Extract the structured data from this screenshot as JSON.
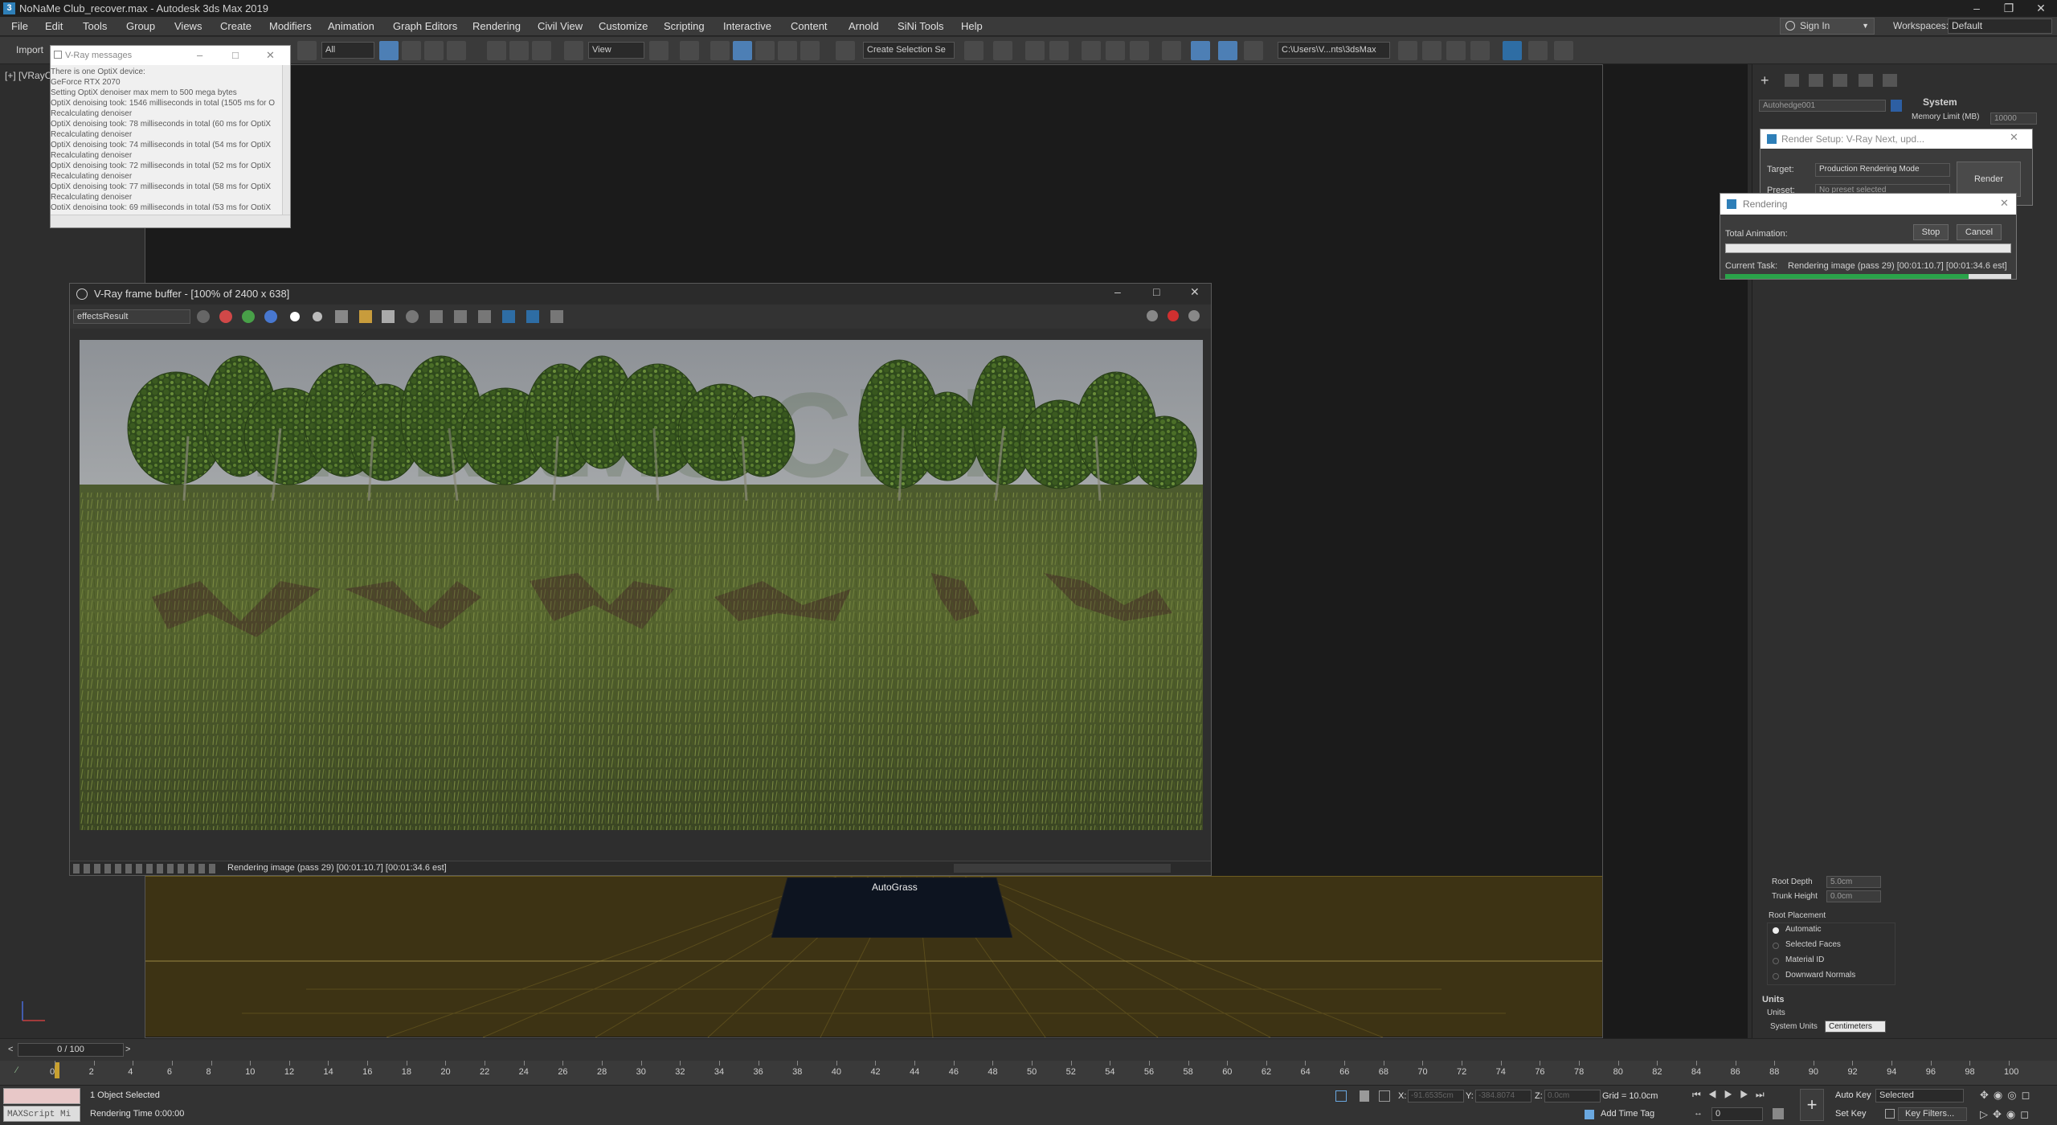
{
  "app": {
    "title": "NoNaMe Club_recover.max - Autodesk 3ds Max 2019",
    "menus": [
      "File",
      "Edit",
      "Tools",
      "Group",
      "Views",
      "Create",
      "Modifiers",
      "Animation",
      "Graph Editors",
      "Rendering",
      "Civil View",
      "Customize",
      "Scripting",
      "Interactive",
      "Content",
      "Arnold",
      "SiNi Tools",
      "Help"
    ],
    "sign_in": "Sign In",
    "workspaces_label": "Workspaces:",
    "workspaces_value": "Default"
  },
  "toolbar": {
    "import": "Import",
    "filter": "All",
    "view": "View",
    "create_selection": "Create Selection Se",
    "path": "C:\\Users\\V...nts\\3dsMax"
  },
  "viewport": {
    "label": "[+] [VRayC",
    "object_label": "AutoGrass"
  },
  "vray_messages": {
    "title": "V-Ray messages",
    "lines": [
      "There is one OptiX device:",
      "  GeForce RTX 2070",
      "Setting OptiX denoiser max mem to 500 mega bytes",
      "OptiX denoising took: 1546 milliseconds in total (1505 ms for O",
      "Recalculating denoiser",
      "OptiX denoising took: 78 milliseconds in total (60 ms for OptiX",
      "Recalculating denoiser",
      "OptiX denoising took: 74 milliseconds in total (54 ms for OptiX",
      "Recalculating denoiser",
      "OptiX denoising took: 72 milliseconds in total (52 ms for OptiX",
      "Recalculating denoiser",
      "OptiX denoising took: 77 milliseconds in total (58 ms for OptiX",
      "Recalculating denoiser",
      "OptiX denoising took: 69 milliseconds in total (53 ms for OptiX"
    ]
  },
  "render_setup": {
    "title": "Render Setup: V-Ray Next, upd...",
    "target_label": "Target:",
    "target_value": "Production Rendering Mode",
    "preset_label": "Preset:",
    "preset_value": "No preset selected",
    "render_button": "Render"
  },
  "rendering_dialog": {
    "title": "Rendering",
    "total_animation": "Total Animation:",
    "stop": "Stop",
    "cancel": "Cancel",
    "current_task_label": "Current Task:",
    "current_task_value": "Rendering image (pass 29) [00:01:10.7] [00:01:34.6 est]",
    "progress": 0.85
  },
  "frame_buffer": {
    "title": "V-Ray frame buffer - [100% of 2400 x 638]",
    "channel": "effectsResult",
    "status": "Rendering image (pass 29) [00:01:10.7] [00:01:34.6 est]"
  },
  "command_panel": {
    "object_name": "Autohedge001",
    "system_header": "System",
    "memory_limit_label": "Memory Limit (MB)",
    "memory_limit_value": "10000",
    "root_depth_label": "Root Depth",
    "root_depth_value": "5.0cm",
    "trunk_height_label": "Trunk Height",
    "trunk_height_value": "0.0cm",
    "root_placement_label": "Root Placement",
    "root_options": [
      "Automatic",
      "Selected Faces",
      "Material ID",
      "Downward Normals"
    ],
    "units_header": "Units",
    "units_label": "Units",
    "system_units_label": "System Units",
    "system_units_value": "Centimeters"
  },
  "timeline": {
    "frame_display": "0 / 100",
    "ticks": [
      "0",
      "2",
      "4",
      "6",
      "8",
      "10",
      "12",
      "14",
      "16",
      "18",
      "20",
      "22",
      "24",
      "26",
      "28",
      "30",
      "32",
      "34",
      "36",
      "38",
      "40",
      "42",
      "44",
      "46",
      "48",
      "50",
      "52",
      "54",
      "56",
      "58",
      "60",
      "62",
      "64",
      "66",
      "68",
      "70",
      "72",
      "74",
      "76",
      "78",
      "80",
      "82",
      "84",
      "86",
      "88",
      "90",
      "92",
      "94",
      "96",
      "98",
      "100"
    ]
  },
  "statusbar": {
    "maxscript": "MAXScript Mi",
    "selected": "1 Object Selected",
    "rendering_time": "Rendering Time  0:00:00",
    "x_label": "X:",
    "x_value": "-91.6535cm",
    "y_label": "Y:",
    "y_value": "-384.8074",
    "z_label": "Z:",
    "z_value": "0.0cm",
    "grid": "Grid = 10.0cm",
    "add_time_tag": "Add Time Tag",
    "auto_key": "Auto Key",
    "selected_dropdown": "Selected",
    "set_key": "Set Key",
    "key_filters": "Key Filters...",
    "frame_field": "0"
  },
  "render_image": {
    "hedge_text": "NoNaMe Club"
  }
}
